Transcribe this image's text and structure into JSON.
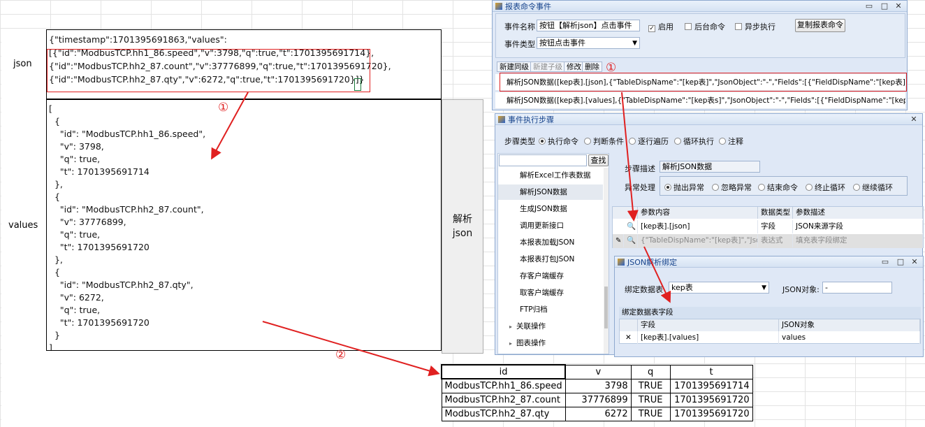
{
  "sheet": {
    "json_label": "json",
    "values_label": "values",
    "json_text": "{\"timestamp\":1701395691863,\"values\":\n[{\"id\":\"ModbusTCP.hh1_86.speed\",\"v\":3798,\"q\":true,\"t\":1701395691714},\n{\"id\":\"ModbusTCP.hh2_87.count\",\"v\":37776899,\"q\":true,\"t\":1701395691720},\n{\"id\":\"ModbusTCP.hh2_87.qty\",\"v\":6272,\"q\":true,\"t\":1701395691720}]}",
    "values_text": "[\n  {\n    \"id\": \"ModbusTCP.hh1_86.speed\",\n    \"v\": 3798,\n    \"q\": true,\n    \"t\": 1701395691714\n  },\n  {\n    \"id\": \"ModbusTCP.hh2_87.count\",\n    \"v\": 37776899,\n    \"q\": true,\n    \"t\": 1701395691720\n  },\n  {\n    \"id\": \"ModbusTCP.hh2_87.qty\",\n    \"v\": 6272,\n    \"q\": true,\n    \"t\": 1701395691720\n  }\n]",
    "parse_button_line1": "解析",
    "parse_button_line2": "json"
  },
  "annotations": {
    "mark1": "①",
    "mark2": "②"
  },
  "result_table": {
    "headers": [
      "id",
      "v",
      "q",
      "t"
    ],
    "rows": [
      [
        "ModbusTCP.hh1_86.speed",
        "3798",
        "TRUE",
        "1701395691714"
      ],
      [
        "ModbusTCP.hh2_87.count",
        "37776899",
        "TRUE",
        "1701395691720"
      ],
      [
        "ModbusTCP.hh2_87.qty",
        "6272",
        "TRUE",
        "1701395691720"
      ]
    ]
  },
  "event_window": {
    "title": "报表命令事件",
    "name_label": "事件名称",
    "name_value": "按钮【解析json】点击事件",
    "enable_label": "启用",
    "background_label": "后台命令",
    "async_label": "异步执行",
    "copy_button": "复制报表命令",
    "type_label": "事件类型",
    "type_value": "按钮点击事件",
    "tabs": [
      "新建同级",
      "新建子级",
      "修改",
      "删除"
    ],
    "rows": [
      "解析JSON数据([kep表].[json],{\"TableDispName\":\"[kep表]\",\"JsonObject\":\"-\",\"Fields\":[{\"FieldDispName\":\"[kep表].[values]\",\"Json...",
      "解析JSON数据([kep表].[values],{\"TableDispName\":\"[kep表s]\",\"JsonObject\":\"-\",\"Fields\":[{\"FieldDispName\":\"[kep表s].[id]\",\"Json..."
    ]
  },
  "steps_window": {
    "title": "事件执行步骤",
    "step_type_label": "步骤类型",
    "step_types": [
      "执行命令",
      "判断条件",
      "逐行遍历",
      "循环执行",
      "注释"
    ],
    "search_button": "查找",
    "list_items": [
      "解析Excel工作表数据",
      "解析JSON数据",
      "生成JSON数据",
      "调用更新接口",
      "本报表加载JSON",
      "本报表打包JSON",
      "存客户端缓存",
      "取客户端缓存",
      "FTP归档"
    ],
    "groups": [
      "关联操作",
      "图表操作"
    ],
    "desc_label": "步骤描述",
    "desc_value": "解析JSON数据",
    "exception_label": "异常处理",
    "exception_options": [
      "抛出异常",
      "忽略异常",
      "结束命令",
      "终止循环",
      "继续循环"
    ],
    "param_headers": [
      "参数内容",
      "数据类型",
      "参数描述"
    ],
    "param_rows": [
      [
        "[kep表].[json]",
        "字段",
        "JSON来源字段"
      ],
      [
        "{\"TableDispName\":\"[kep表]\",\"Json...",
        "表达式",
        "填充表字段绑定"
      ]
    ]
  },
  "bind_window": {
    "title": "JSON解析绑定",
    "table_label": "绑定数据表",
    "table_value": "kep表",
    "json_object_label": "JSON对象:",
    "json_object_value": "-",
    "fields_header": "绑定数据表字段",
    "col_field": "字段",
    "col_json": "JSON对象",
    "row_field": "[kep表].[values]",
    "row_json": "values"
  }
}
